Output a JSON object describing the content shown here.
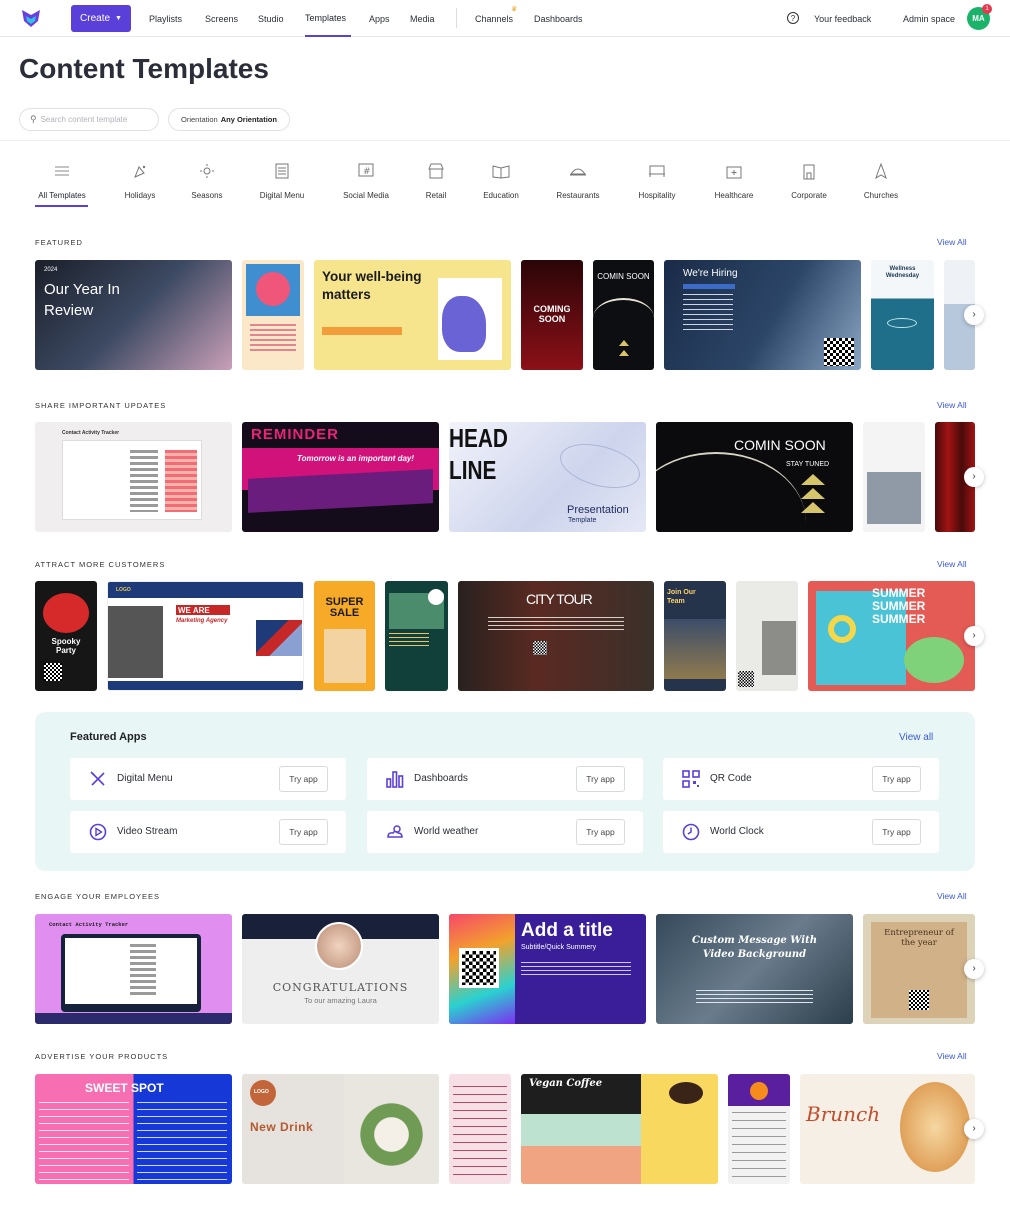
{
  "header": {
    "create_label": "Create",
    "nav": [
      "Playlists",
      "Screens",
      "Studio",
      "Templates",
      "Apps",
      "Media",
      "Channels",
      "Dashboards"
    ],
    "feedback": "Your feedback",
    "workspace": "Admin space",
    "avatar_initials": "MA",
    "notification_count": "1",
    "accent": "#5b3fd9"
  },
  "page_title": "Content Templates",
  "filters": {
    "search_placeholder": "Search content template",
    "orientation_label": "Orientation",
    "orientation_value": "Any Orientation"
  },
  "categories": [
    "All Templates",
    "Holidays",
    "Seasons",
    "Digital Menu",
    "Social Media",
    "Retail",
    "Education",
    "Restaurants",
    "Hospitality",
    "Healthcare",
    "Corporate",
    "Churches"
  ],
  "sections": {
    "featured": "FEATURED",
    "updates": "SHARE IMPORTANT UPDATES",
    "customers": "ATTRACT MORE CUSTOMERS",
    "employees": "ENGAGE YOUR EMPLOYEES",
    "products": "ADVERTISE YOUR PRODUCTS",
    "view_all": "View All"
  },
  "tiles": {
    "year_small": "2024",
    "year_review": "Our Year In Review",
    "wellbeing": "Your well-being matters",
    "coming_soon": "COMING SOON",
    "comin_soon_small": "COMIN SOON",
    "hiring": "We're Hiring",
    "wellness": "Wellness Wednesday",
    "reminder": "REMINDER",
    "reminder_sub": "Tomorrow is an important day!",
    "headline_a": "HEAD",
    "headline_b": "LINE",
    "presentation": "Presentation",
    "presentation_sub": "Template",
    "comin_soon": "COMIN SOON",
    "stay_tuned": "STAY TUNED",
    "activity": "Contact Activity Tracker",
    "spooky": "Spooky Party",
    "we_are": "WE ARE",
    "marketing": "Marketing Agency",
    "super_sale": "SUPER SALE",
    "city_tour": "CITY TOUR",
    "join_team": "Join Our Team",
    "summer": "SUMMER",
    "congrats": "CONGRATULATIONS",
    "congrats_sub": "To our amazing Laura",
    "add_title": "Add a title",
    "add_title_sub": "Subtitle/Quick Summery",
    "custom_msg": "Custom Message With Video Background",
    "entrepreneur": "Entrepreneur of the year",
    "sweet_spot": "SWEET SPOT",
    "new_drink": "New Drink",
    "vegan_coffee": "Vegan Coffee",
    "brunch": "Brunch",
    "logo": "LOGO"
  },
  "apps_panel": {
    "title": "Featured Apps",
    "view_all": "View all",
    "try_label": "Try app",
    "items": [
      "Digital Menu",
      "Dashboards",
      "QR Code",
      "Video Stream",
      "World weather",
      "World Clock"
    ]
  }
}
